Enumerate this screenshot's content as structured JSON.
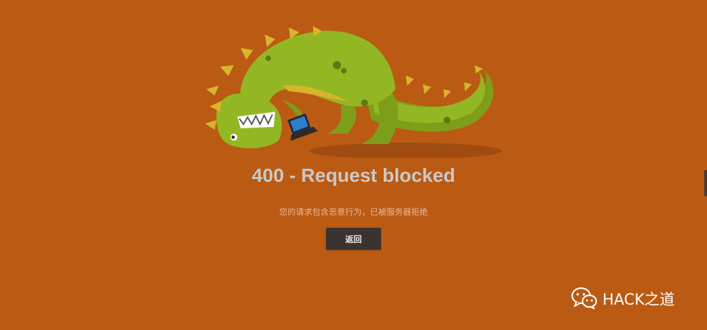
{
  "error": {
    "title": "400 - Request blocked",
    "message": "您的请求包含恶意行为，已被服务器拒绝",
    "back_label": "返回"
  },
  "watermark": {
    "text": "HACK之道",
    "icon": "wechat-icon"
  },
  "colors": {
    "background": "#bb5a13",
    "dino": "#8fb21f",
    "button": "#3b3330"
  }
}
